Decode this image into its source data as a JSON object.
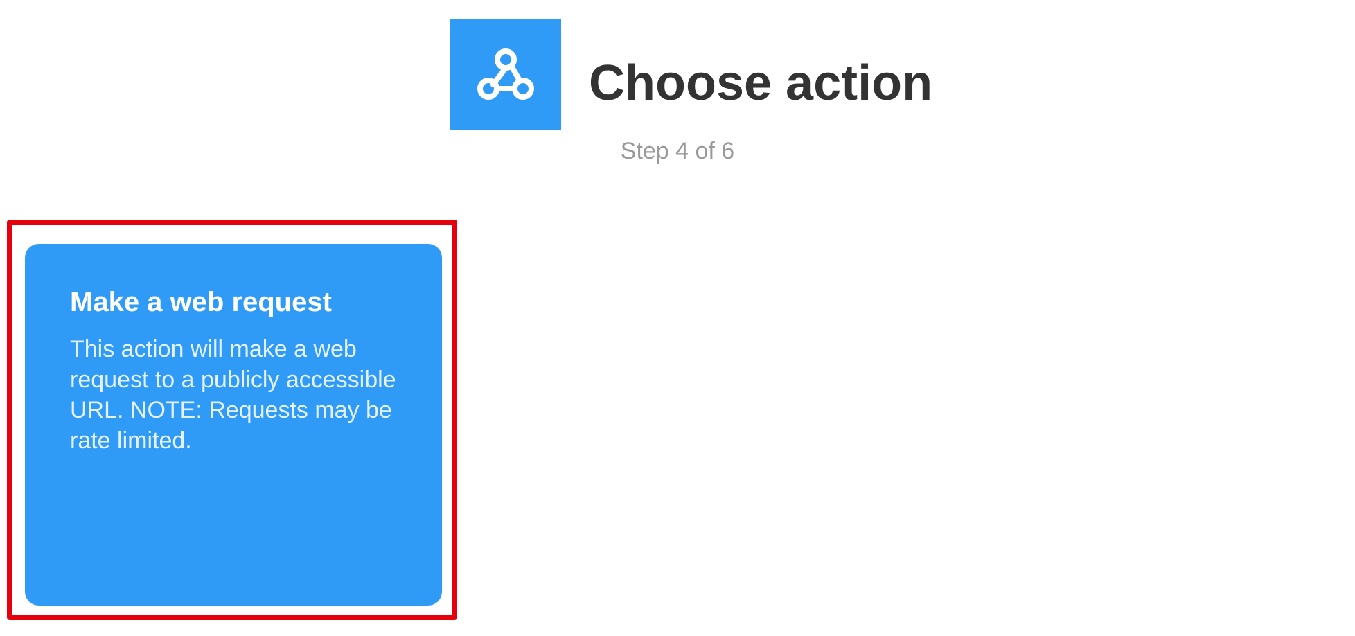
{
  "colors": {
    "brand_blue": "#2f9bf7",
    "highlight_red": "#e5000d",
    "title_text": "#333333",
    "muted_text": "#999999"
  },
  "header": {
    "service_icon": "webhooks-icon",
    "title": "Choose action",
    "step_label": "Step 4 of 6"
  },
  "actions": [
    {
      "title": "Make a web request",
      "description": "This action will make a web request to a publicly accessible URL. NOTE: Requests may be rate limited.",
      "highlighted": true
    }
  ]
}
